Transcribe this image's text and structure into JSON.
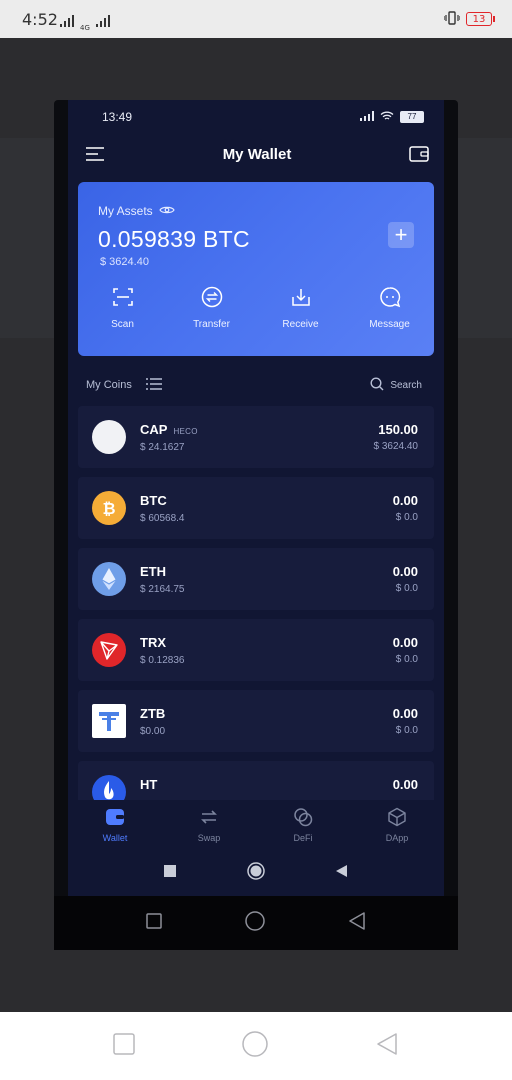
{
  "device": {
    "time": "4:52",
    "network": "4G",
    "battery": "13"
  },
  "app": {
    "status_time": "13:49",
    "status_battery": "77",
    "title": "My Wallet"
  },
  "assets": {
    "label": "My Assets",
    "amount": "0.059839 BTC",
    "usd": "$ 3624.40",
    "actions": [
      {
        "label": "Scan",
        "icon": "scan-icon"
      },
      {
        "label": "Transfer",
        "icon": "transfer-icon"
      },
      {
        "label": "Receive",
        "icon": "receive-icon"
      },
      {
        "label": "Message",
        "icon": "message-icon"
      }
    ]
  },
  "coins_header": {
    "label": "My Coins",
    "search": "Search"
  },
  "coins": [
    {
      "symbol": "CAP",
      "chain": "HECO",
      "price": "$ 24.1627",
      "balance": "150.00",
      "value": "$ 3624.40"
    },
    {
      "symbol": "BTC",
      "chain": "",
      "price": "$ 60568.4",
      "balance": "0.00",
      "value": "$ 0.0"
    },
    {
      "symbol": "ETH",
      "chain": "",
      "price": "$ 2164.75",
      "balance": "0.00",
      "value": "$ 0.0"
    },
    {
      "symbol": "TRX",
      "chain": "",
      "price": "$ 0.12836",
      "balance": "0.00",
      "value": "$ 0.0"
    },
    {
      "symbol": "ZTB",
      "chain": "",
      "price": "$0.00",
      "balance": "0.00",
      "value": "$ 0.0"
    },
    {
      "symbol": "HT",
      "chain": "",
      "price": "",
      "balance": "0.00",
      "value": ""
    }
  ],
  "tabs": [
    {
      "label": "Wallet",
      "active": true
    },
    {
      "label": "Swap",
      "active": false
    },
    {
      "label": "DeFi",
      "active": false
    },
    {
      "label": "DApp",
      "active": false
    }
  ],
  "colors": {
    "accent": "#4f7cff",
    "card": "#4a73f0",
    "background": "#111633",
    "row": "#171c3c"
  }
}
